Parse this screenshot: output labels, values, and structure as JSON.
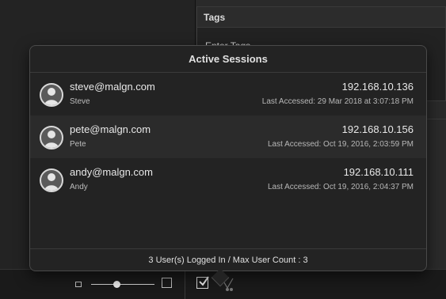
{
  "tags_panel": {
    "title": "Tags",
    "input_placeholder": "Enter Tags"
  },
  "popover": {
    "title": "Active Sessions",
    "footer": "3 User(s) Logged In / Max User Count : 3"
  },
  "sessions": [
    {
      "email": "steve@malgn.com",
      "name": "Steve",
      "ip": "192.168.10.136",
      "last_accessed": "Last Accessed: 29 Mar 2018 at 3:07:18 PM"
    },
    {
      "email": "pete@malgn.com",
      "name": "Pete",
      "ip": "192.168.10.156",
      "last_accessed": "Last Accessed: Oct 19, 2016, 2:03:59 PM"
    },
    {
      "email": "andy@malgn.com",
      "name": "Andy",
      "ip": "192.168.10.111",
      "last_accessed": "Last Accessed: Oct 19, 2016, 2:04:37 PM"
    }
  ],
  "toolbar": {
    "zoom_slider_value": 0.4,
    "icons": [
      "zoom-small-icon",
      "zoom-large-icon",
      "checkbox-icon",
      "branch-icon"
    ]
  },
  "colors": {
    "background": "#1e1e1e",
    "popover": "#232323",
    "row_alt": "#2b2b2b",
    "text": "#e8e8e8"
  }
}
